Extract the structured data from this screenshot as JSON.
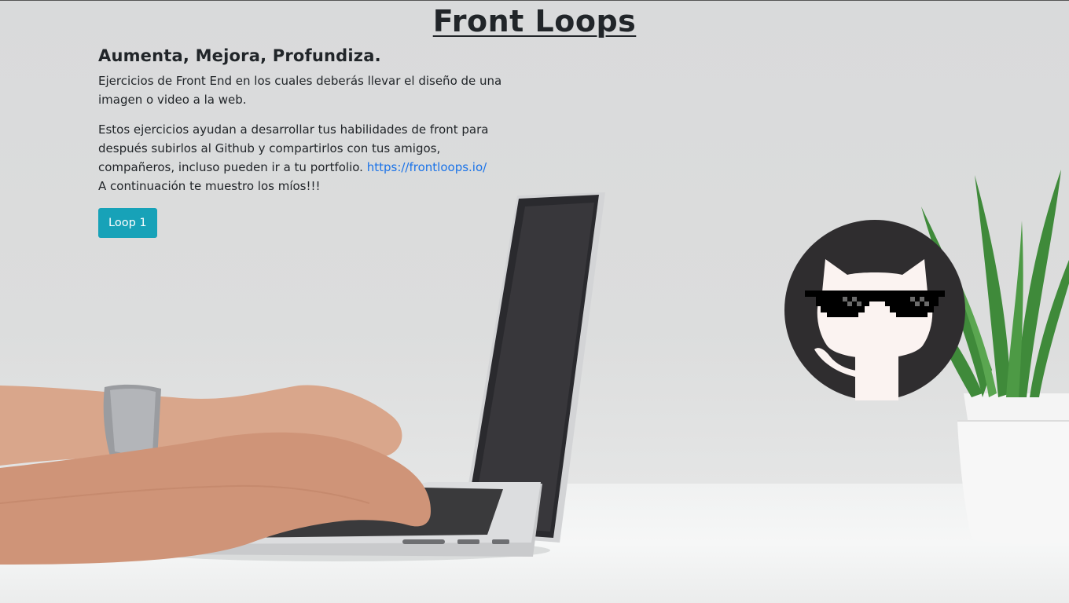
{
  "header": {
    "title": "Front Loops"
  },
  "intro": {
    "heading": "Aumenta, Mejora, Profundiza.",
    "paragraph1": "Ejercicios de Front End en los cuales deberás llevar el diseño de una imagen o video a la web.",
    "paragraph2_text": "Estos ejercicios ayudan a desarrollar tus habilidades de front para después subirlos al Github y compartirlos con tus amigos, compañeros, incluso pueden ir a tu portfolio.",
    "link_text": "https://frontloops.io/",
    "paragraph2_tail": "A continuación te muestro los míos!!!"
  },
  "actions": {
    "loop1_label": "Loop 1"
  },
  "icons": {
    "avatar": "github-octocat-with-sunglasses-icon"
  },
  "colors": {
    "button": "#17a2b8",
    "link": "#1a73e8",
    "text": "#212529"
  }
}
